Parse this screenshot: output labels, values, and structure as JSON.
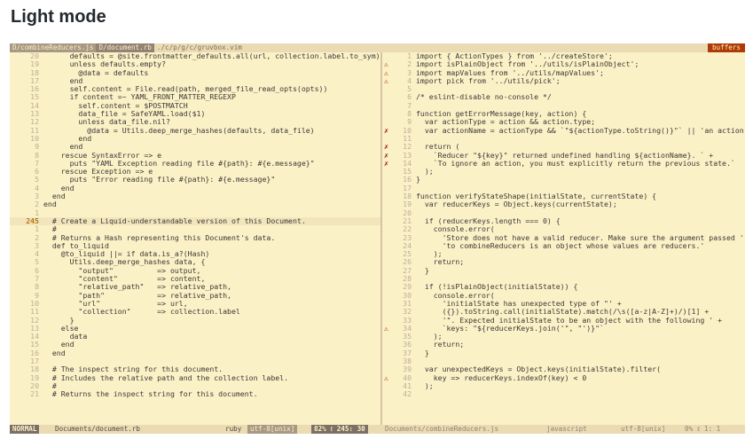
{
  "heading": "Light mode",
  "tabline": {
    "tabs": [
      "D/combineReducers.js",
      "D/document.rb",
      "./c/p/g/c/gruvbox.vim"
    ],
    "buffers_label": "buffers"
  },
  "left_pane": {
    "lines": [
      {
        "num": "20",
        "code": "      defaults = @site.frontmatter_defaults.all(url, collection.label.to_sym)"
      },
      {
        "num": "19",
        "code": "      unless defaults.empty?"
      },
      {
        "num": "18",
        "code": "        @data = defaults"
      },
      {
        "num": "17",
        "code": "      end"
      },
      {
        "num": "16",
        "code": "      self.content = File.read(path, merged_file_read_opts(opts))"
      },
      {
        "num": "15",
        "code": "      if content =~ YAML_FRONT_MATTER_REGEXP"
      },
      {
        "num": "14",
        "code": "        self.content = $POSTMATCH"
      },
      {
        "num": "13",
        "code": "        data_file = SafeYAML.load($1)"
      },
      {
        "num": "12",
        "code": "        unless data_file.nil?"
      },
      {
        "num": "11",
        "code": "          @data = Utils.deep_merge_hashes(defaults, data_file)"
      },
      {
        "num": "10",
        "code": "        end"
      },
      {
        "num": "9",
        "code": "      end"
      },
      {
        "num": "8",
        "code": "    rescue SyntaxError => e"
      },
      {
        "num": "7",
        "code": "      puts \"YAML Exception reading file #{path}: #{e.message}\""
      },
      {
        "num": "6",
        "code": "    rescue Exception => e"
      },
      {
        "num": "5",
        "code": "      puts \"Error reading file #{path}: #{e.message}\""
      },
      {
        "num": "4",
        "code": "    end"
      },
      {
        "num": "3",
        "code": "  end"
      },
      {
        "num": "2",
        "code": "end"
      },
      {
        "num": "1",
        "code": ""
      },
      {
        "num": "245",
        "code": "  # Create a Liquid-understandable version of this Document.",
        "current": true
      },
      {
        "num": "1",
        "code": "  #"
      },
      {
        "num": "2",
        "code": "  # Returns a Hash representing this Document's data."
      },
      {
        "num": "3",
        "code": "  def to_liquid"
      },
      {
        "num": "4",
        "code": "    @to_liquid ||= if data.is_a?(Hash)"
      },
      {
        "num": "5",
        "code": "      Utils.deep_merge_hashes data, {"
      },
      {
        "num": "6",
        "code": "        \"output\"          => output,"
      },
      {
        "num": "7",
        "code": "        \"content\"         => content,"
      },
      {
        "num": "8",
        "code": "        \"relative_path\"   => relative_path,"
      },
      {
        "num": "9",
        "code": "        \"path\"            => relative_path,"
      },
      {
        "num": "10",
        "code": "        \"url\"             => url,"
      },
      {
        "num": "11",
        "code": "        \"collection\"      => collection.label"
      },
      {
        "num": "12",
        "code": "      }"
      },
      {
        "num": "13",
        "code": "    else"
      },
      {
        "num": "14",
        "code": "      data"
      },
      {
        "num": "15",
        "code": "    end"
      },
      {
        "num": "16",
        "code": "  end"
      },
      {
        "num": "17",
        "code": ""
      },
      {
        "num": "18",
        "code": "  # The inspect string for this document."
      },
      {
        "num": "19",
        "code": "  # Includes the relative path and the collection label."
      },
      {
        "num": "20",
        "code": "  #"
      },
      {
        "num": "21",
        "code": "  # Returns the inspect string for this document."
      }
    ]
  },
  "right_pane": {
    "lines": [
      {
        "sign": "",
        "num": "1",
        "code": "import { ActionTypes } from '../createStore';"
      },
      {
        "sign": "⚠",
        "num": "2",
        "code": "import isPlainObject from '../utils/isPlainObject';"
      },
      {
        "sign": "⚠",
        "num": "3",
        "code": "import mapValues from '../utils/mapValues';"
      },
      {
        "sign": "⚠",
        "num": "4",
        "code": "import pick from '../utils/pick';"
      },
      {
        "sign": "",
        "num": "5",
        "code": ""
      },
      {
        "sign": "",
        "num": "6",
        "code": "/* eslint-disable no-console */"
      },
      {
        "sign": "",
        "num": "7",
        "code": ""
      },
      {
        "sign": "",
        "num": "8",
        "code": "function getErrorMessage(key, action) {"
      },
      {
        "sign": "",
        "num": "9",
        "code": "  var actionType = action && action.type;"
      },
      {
        "sign": "✗",
        "num": "10",
        "code": "  var actionName = actionType && `\"${actionType.toString()}\"` || 'an action';"
      },
      {
        "sign": "",
        "num": "11",
        "code": ""
      },
      {
        "sign": "✗",
        "num": "12",
        "code": "  return ("
      },
      {
        "sign": "✗",
        "num": "13",
        "code": "    `Reducer \"${key}\" returned undefined handling ${actionName}. ` +"
      },
      {
        "sign": "✗",
        "num": "14",
        "code": "    `To ignore an action, you must explicitly return the previous state.`"
      },
      {
        "sign": "",
        "num": "15",
        "code": "  );"
      },
      {
        "sign": "",
        "num": "16",
        "code": "}"
      },
      {
        "sign": "",
        "num": "17",
        "code": ""
      },
      {
        "sign": "",
        "num": "18",
        "code": "function verifyStateShape(initialState, currentState) {"
      },
      {
        "sign": "",
        "num": "19",
        "code": "  var reducerKeys = Object.keys(currentState);"
      },
      {
        "sign": "",
        "num": "20",
        "code": ""
      },
      {
        "sign": "",
        "num": "21",
        "code": "  if (reducerKeys.length === 0) {"
      },
      {
        "sign": "",
        "num": "22",
        "code": "    console.error("
      },
      {
        "sign": "",
        "num": "23",
        "code": "      'Store does not have a valid reducer. Make sure the argument passed ' +"
      },
      {
        "sign": "",
        "num": "24",
        "code": "      'to combineReducers is an object whose values are reducers.'"
      },
      {
        "sign": "",
        "num": "25",
        "code": "    );"
      },
      {
        "sign": "",
        "num": "26",
        "code": "    return;"
      },
      {
        "sign": "",
        "num": "27",
        "code": "  }"
      },
      {
        "sign": "",
        "num": "28",
        "code": ""
      },
      {
        "sign": "",
        "num": "29",
        "code": "  if (!isPlainObject(initialState)) {"
      },
      {
        "sign": "",
        "num": "30",
        "code": "    console.error("
      },
      {
        "sign": "",
        "num": "31",
        "code": "      'initialState has unexpected type of \"' +"
      },
      {
        "sign": "",
        "num": "32",
        "code": "      ({}).toString.call(initialState).match(/\\s([a-z|A-Z]+)/)[1] +"
      },
      {
        "sign": "",
        "num": "33",
        "code": "      '\". Expected initialState to be an object with the following ' +"
      },
      {
        "sign": "⚠",
        "num": "34",
        "code": "      `keys: \"${reducerKeys.join('\", \"')}\"`"
      },
      {
        "sign": "",
        "num": "35",
        "code": "    );"
      },
      {
        "sign": "",
        "num": "36",
        "code": "    return;"
      },
      {
        "sign": "",
        "num": "37",
        "code": "  }"
      },
      {
        "sign": "",
        "num": "38",
        "code": ""
      },
      {
        "sign": "",
        "num": "39",
        "code": "  var unexpectedKeys = Object.keys(initialState).filter("
      },
      {
        "sign": "⚠",
        "num": "40",
        "code": "    key => reducerKeys.indexOf(key) < 0"
      },
      {
        "sign": "",
        "num": "41",
        "code": "  );"
      },
      {
        "sign": "",
        "num": "42",
        "code": ""
      }
    ]
  },
  "statusline": {
    "mode": "NORMAL",
    "left_file": "Documents/document.rb",
    "left_filetype": "ruby",
    "left_encoding": "utf-8[unix]",
    "left_position": "82% ℓ 245: 30",
    "right_file": "Documents/combineReducers.js",
    "right_filetype": "javascript",
    "right_encoding": "utf-8[unix]",
    "right_position": "0% ℓ   1:  1"
  }
}
